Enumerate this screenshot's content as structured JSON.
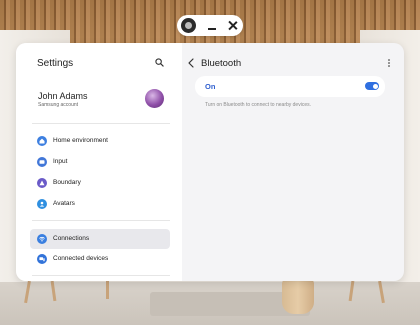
{
  "colors": {
    "accent": "#2f6fe0",
    "on_label": "#2f5fcf",
    "home_icon": "#3d7fe0",
    "input_icon": "#4277d8",
    "boundary_icon": "#6a5ac8",
    "avatars_icon": "#2f8fe0",
    "connections_icon": "#3a7fe0",
    "connected_devices_icon": "#3273d9"
  },
  "settings": {
    "title": "Settings",
    "search_icon": "search-icon",
    "account": {
      "name": "John Adams",
      "subtitle": "Samsung account"
    },
    "menu": [
      {
        "label": "Home environment",
        "icon": "home-icon",
        "selected": false
      },
      {
        "label": "Input",
        "icon": "input-icon",
        "selected": false
      },
      {
        "label": "Boundary",
        "icon": "boundary-icon",
        "selected": false
      },
      {
        "label": "Avatars",
        "icon": "avatar-icon",
        "selected": false
      },
      {
        "label": "Connections",
        "icon": "wifi-icon",
        "selected": true
      },
      {
        "label": "Connected devices",
        "icon": "devices-icon",
        "selected": false
      }
    ]
  },
  "detail": {
    "title": "Bluetooth",
    "toggle_label": "On",
    "toggle_on": true,
    "hint": "Turn on Bluetooth to connect to nearby devices."
  }
}
